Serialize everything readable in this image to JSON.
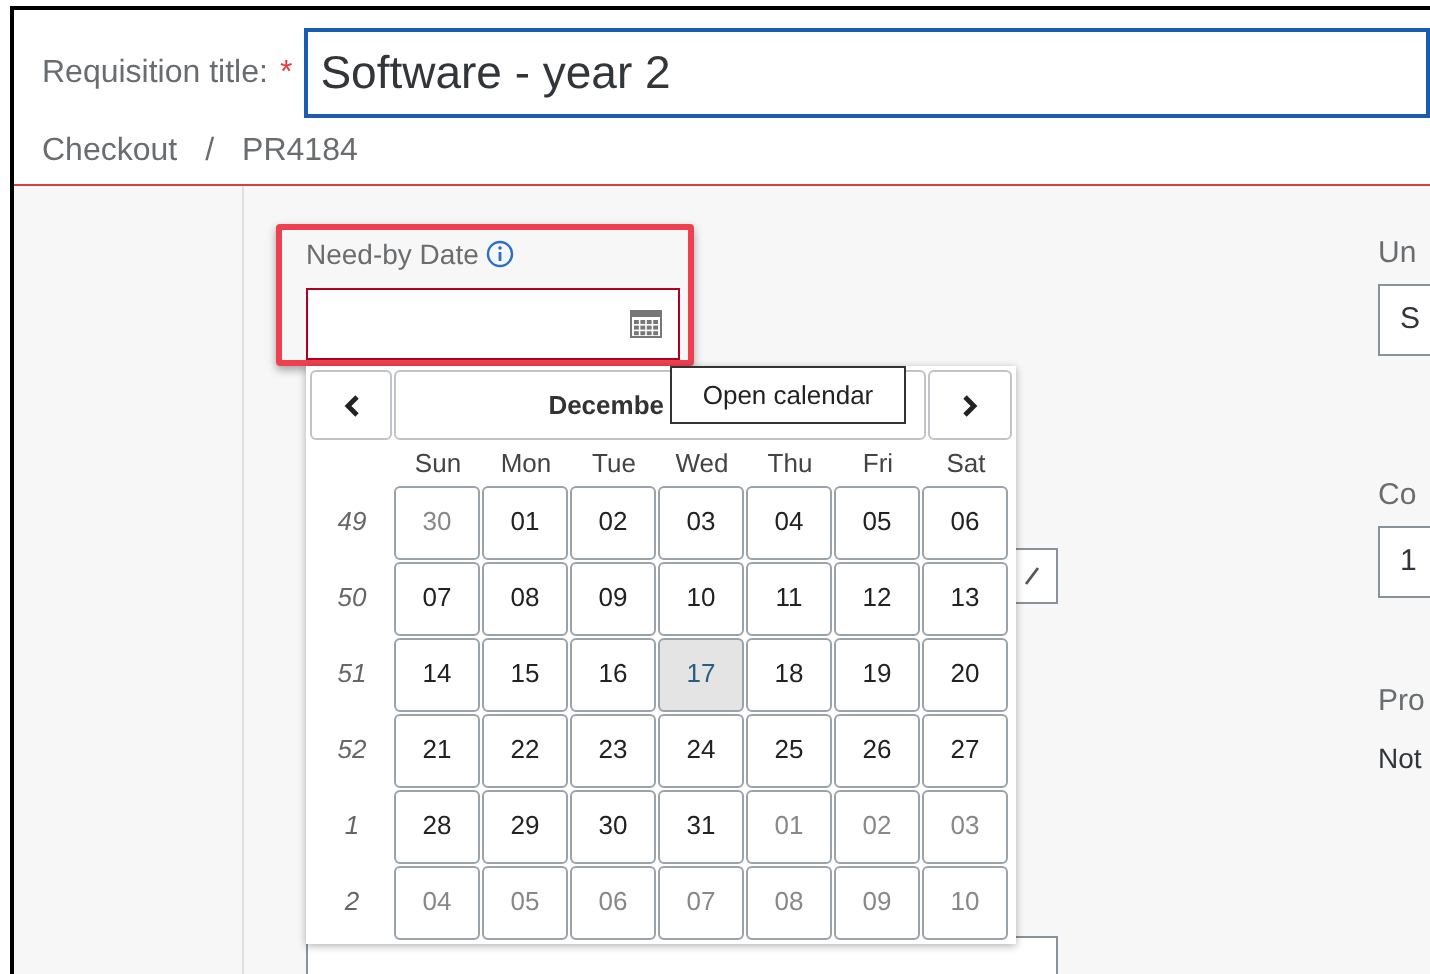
{
  "header": {
    "title_label": "Requisition title:",
    "required_mark": "*",
    "title_value": "Software - year 2",
    "breadcrumb": [
      "Checkout",
      "PR4184"
    ],
    "separator": "/"
  },
  "need_by": {
    "label": "Need-by Date",
    "highlighted": true
  },
  "calendar": {
    "month_label": "Decembe",
    "tooltip": "Open calendar",
    "weekdays": [
      "Sun",
      "Mon",
      "Tue",
      "Wed",
      "Thu",
      "Fri",
      "Sat"
    ],
    "weeks": [
      {
        "number": "49",
        "days": [
          {
            "label": "30",
            "outside": true,
            "today": false
          },
          {
            "label": "01",
            "outside": false,
            "today": false
          },
          {
            "label": "02",
            "outside": false,
            "today": false
          },
          {
            "label": "03",
            "outside": false,
            "today": false
          },
          {
            "label": "04",
            "outside": false,
            "today": false
          },
          {
            "label": "05",
            "outside": false,
            "today": false
          },
          {
            "label": "06",
            "outside": false,
            "today": false
          }
        ]
      },
      {
        "number": "50",
        "days": [
          {
            "label": "07",
            "outside": false,
            "today": false
          },
          {
            "label": "08",
            "outside": false,
            "today": false
          },
          {
            "label": "09",
            "outside": false,
            "today": false
          },
          {
            "label": "10",
            "outside": false,
            "today": false
          },
          {
            "label": "11",
            "outside": false,
            "today": false
          },
          {
            "label": "12",
            "outside": false,
            "today": false
          },
          {
            "label": "13",
            "outside": false,
            "today": false
          }
        ]
      },
      {
        "number": "51",
        "days": [
          {
            "label": "14",
            "outside": false,
            "today": false
          },
          {
            "label": "15",
            "outside": false,
            "today": false
          },
          {
            "label": "16",
            "outside": false,
            "today": false
          },
          {
            "label": "17",
            "outside": false,
            "today": true
          },
          {
            "label": "18",
            "outside": false,
            "today": false
          },
          {
            "label": "19",
            "outside": false,
            "today": false
          },
          {
            "label": "20",
            "outside": false,
            "today": false
          }
        ]
      },
      {
        "number": "52",
        "days": [
          {
            "label": "21",
            "outside": false,
            "today": false
          },
          {
            "label": "22",
            "outside": false,
            "today": false
          },
          {
            "label": "23",
            "outside": false,
            "today": false
          },
          {
            "label": "24",
            "outside": false,
            "today": false
          },
          {
            "label": "25",
            "outside": false,
            "today": false
          },
          {
            "label": "26",
            "outside": false,
            "today": false
          },
          {
            "label": "27",
            "outside": false,
            "today": false
          }
        ]
      },
      {
        "number": "1",
        "days": [
          {
            "label": "28",
            "outside": false,
            "today": false
          },
          {
            "label": "29",
            "outside": false,
            "today": false
          },
          {
            "label": "30",
            "outside": false,
            "today": false
          },
          {
            "label": "31",
            "outside": false,
            "today": false
          },
          {
            "label": "01",
            "outside": true,
            "today": false
          },
          {
            "label": "02",
            "outside": true,
            "today": false
          },
          {
            "label": "03",
            "outside": true,
            "today": false
          }
        ]
      },
      {
        "number": "2",
        "days": [
          {
            "label": "04",
            "outside": true,
            "today": false
          },
          {
            "label": "05",
            "outside": true,
            "today": false
          },
          {
            "label": "06",
            "outside": true,
            "today": false
          },
          {
            "label": "07",
            "outside": true,
            "today": false
          },
          {
            "label": "08",
            "outside": true,
            "today": false
          },
          {
            "label": "09",
            "outside": true,
            "today": false
          },
          {
            "label": "10",
            "outside": true,
            "today": false
          }
        ]
      }
    ]
  },
  "right_column": [
    {
      "kind": "input",
      "label": "Un",
      "value": "S"
    },
    {
      "kind": "input",
      "label": "Co",
      "value": "1"
    },
    {
      "kind": "text",
      "label": "Pro",
      "value": "Not"
    }
  ]
}
